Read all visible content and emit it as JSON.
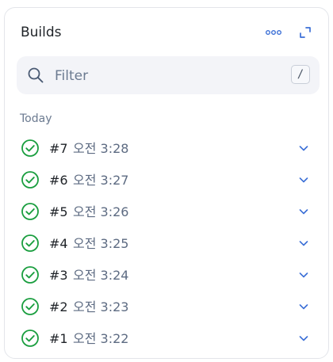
{
  "header": {
    "title": "Builds",
    "more_icon": "ellipsis-icon",
    "expand_icon": "expand-icon"
  },
  "filter": {
    "placeholder": "Filter",
    "value": "",
    "shortcut": "/",
    "icon": "search-icon"
  },
  "builds": {
    "section_label": "Today",
    "items": [
      {
        "number": "#7",
        "time": "오전 3:28",
        "status": "success"
      },
      {
        "number": "#6",
        "time": "오전 3:27",
        "status": "success"
      },
      {
        "number": "#5",
        "time": "오전 3:26",
        "status": "success"
      },
      {
        "number": "#4",
        "time": "오전 3:25",
        "status": "success"
      },
      {
        "number": "#3",
        "time": "오전 3:24",
        "status": "success"
      },
      {
        "number": "#2",
        "time": "오전 3:23",
        "status": "success"
      },
      {
        "number": "#1",
        "time": "오전 3:22",
        "status": "success"
      }
    ]
  },
  "colors": {
    "success": "#1a9e3f",
    "muted_text": "#6b7a90",
    "accent_icon": "#3b6fd6"
  }
}
